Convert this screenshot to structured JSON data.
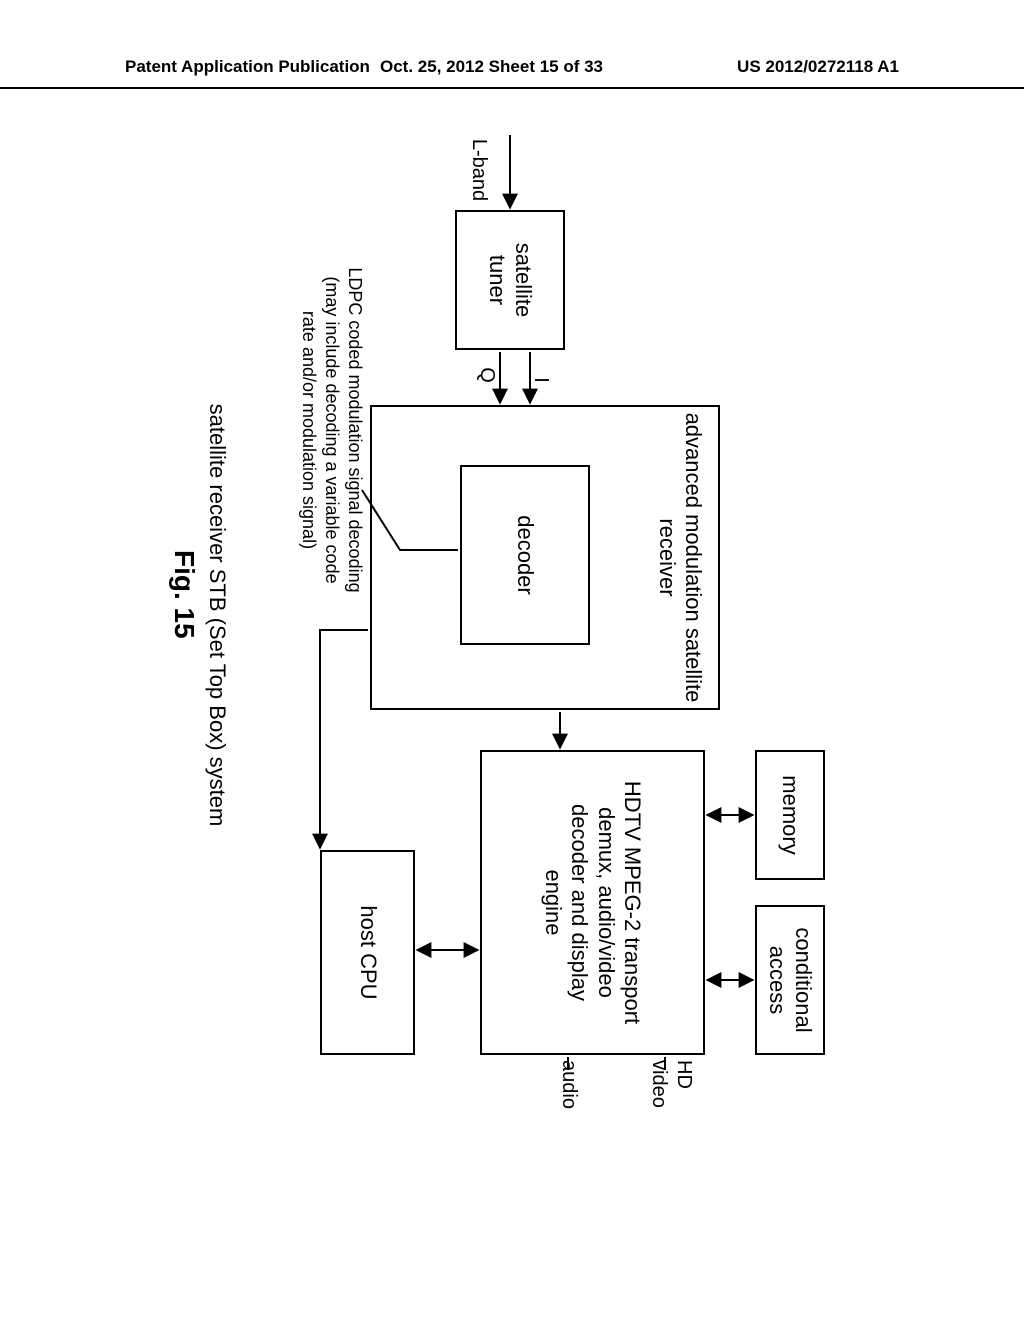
{
  "header": {
    "left": "Patent Application Publication",
    "middle": "Oct. 25, 2012  Sheet 15 of 33",
    "right": "US 2012/0272118 A1"
  },
  "blocks": {
    "sat_tuner_l1": "satellite",
    "sat_tuner_l2": "tuner",
    "receiver_l1": "advanced modulation satellite",
    "receiver_l2": "receiver",
    "decoder": "decoder",
    "memory": "memory",
    "cond_access_l1": "conditional",
    "cond_access_l2": "access",
    "engine_l1": "HDTV MPEG-2 transport",
    "engine_l2": "demux, audio/video",
    "engine_l3": "decoder and display",
    "engine_l4": "engine",
    "host_cpu": "host CPU"
  },
  "signals": {
    "lband": "L-band",
    "i": "I",
    "q": "Q",
    "hd": "HD",
    "video": "video",
    "audio": "audio"
  },
  "notes": {
    "ldpc_l1": "LDPC coded modulation signal decoding",
    "ldpc_l2": "(may include decoding a variable code",
    "ldpc_l3": "rate and/or modulation signal)"
  },
  "caption": {
    "line1": "satellite receiver STB (Set Top Box) system",
    "fig": "Fig. 15"
  }
}
